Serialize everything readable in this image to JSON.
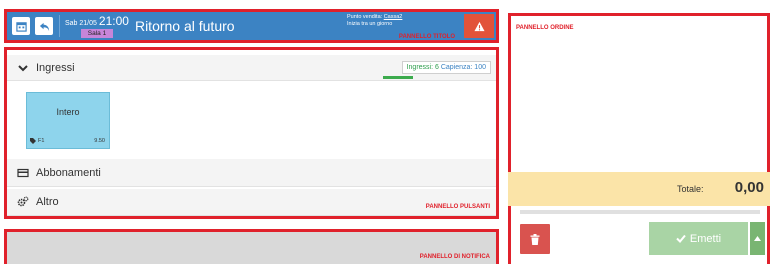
{
  "colors": {
    "title_bar": "#3c83c3",
    "annotation_border": "#e0212b",
    "sala_badge": "#c785d9",
    "tile": "#8ed4ec",
    "capacity_bar": "#3cab4d",
    "warning_button": "#e2533a",
    "total_row": "#fbe4a8",
    "delete_button": "#d9534f",
    "emetti_button": "#a9d4a5",
    "notify_panel": "#d9d9d9"
  },
  "title_panel": {
    "calendar_icon": "calendar-icon",
    "back_icon": "undo-arrow-icon",
    "date": "Sab 21/05",
    "time": "21:00",
    "sala": "Sala 1",
    "movie_title": "Ritorno al futuro",
    "punto_vendita_label": "Punto vendita:",
    "punto_vendita_value": "Cassa2",
    "start_info": "Inizia tra un giorno",
    "warning_icon": "warning-icon",
    "annotation": "PANNELLO TITOLO"
  },
  "buttons_panel": {
    "ingressi": {
      "icon": "chevron-down-icon",
      "label": "Ingressi",
      "capacity_ingressi": "Ingressi: 6",
      "capacity_capienza": "Capienza: 100",
      "capacity_fill_fraction": 0.06,
      "tiles": [
        {
          "label": "Intero",
          "tag": "F1",
          "price": "9.50"
        }
      ]
    },
    "abbonamenti": {
      "icon": "credit-card-icon",
      "label": "Abbonamenti"
    },
    "altro": {
      "icon": "gears-icon",
      "label": "Altro"
    },
    "annotation": "PANNELLO PULSANTI"
  },
  "notify_panel": {
    "annotation": "PANNELLO DI NOTIFICA"
  },
  "order_panel": {
    "annotation": "PANNELLO ORDINE",
    "total_label": "Totale:",
    "total_value": "0,00",
    "delete_icon": "trash-icon",
    "emetti_label": "Emetti",
    "emetti_icon": "check-icon",
    "caret_icon": "caret-up-icon"
  }
}
